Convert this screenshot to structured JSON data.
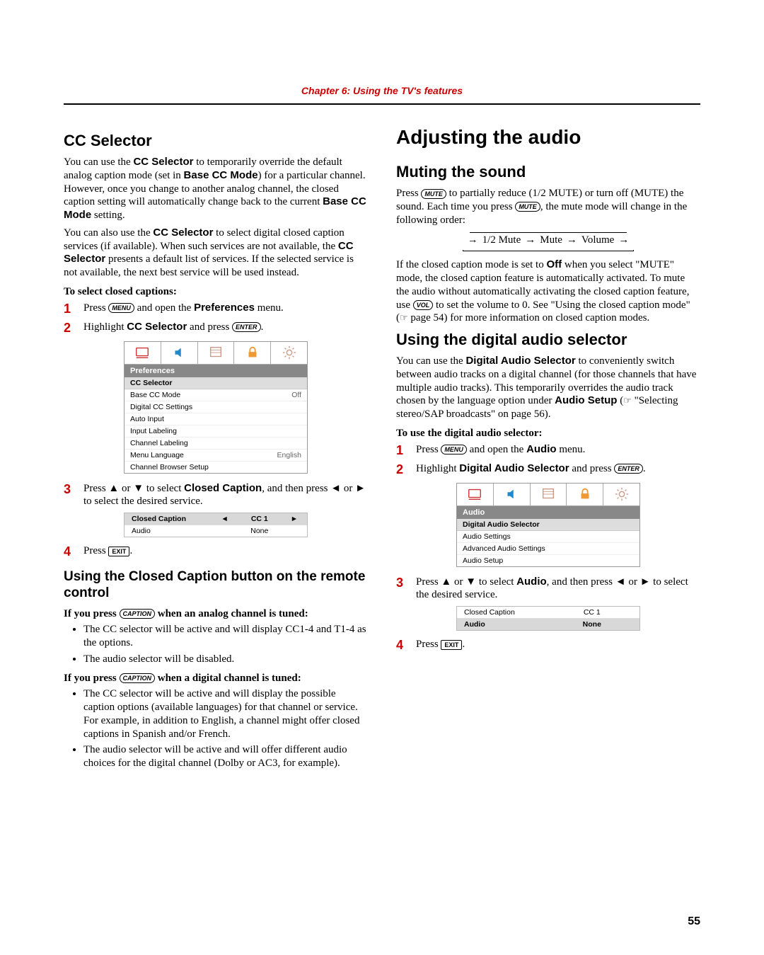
{
  "chapter_title": "Chapter 6: Using the TV's features",
  "page_number": "55",
  "left": {
    "h_cc_selector": "CC Selector",
    "p1a": "You can use the ",
    "p1b": "CC Selector",
    "p1c": " to temporarily override the default analog caption mode (set in ",
    "p1d": "Base CC Mode",
    "p1e": ") for a particular channel. However, once you change to another analog channel, the closed caption setting will automatically change back to the current ",
    "p1f": "Base CC Mode",
    "p1g": " setting.",
    "p2a": "You can also use the ",
    "p2b": "CC Selector",
    "p2c": " to select digital closed caption services (if available). When such services are not available, the ",
    "p2d": "CC Selector",
    "p2e": " presents a default list of services. If the selected service is not available, the next best service will be used instead.",
    "sub_select": "To select closed captions:",
    "s1a": "Press ",
    "s1b": " and open the ",
    "s1c": "Preferences",
    "s1d": " menu.",
    "s2a": "Highlight ",
    "s2b": "CC Selector",
    "s2c": " and press ",
    "s2d": ".",
    "menu1": {
      "head": "Preferences",
      "sel": "CC Selector",
      "rows": [
        {
          "label": "Base CC Mode",
          "val": "Off"
        },
        {
          "label": "Digital CC Settings",
          "val": ""
        },
        {
          "label": "Auto Input",
          "val": ""
        },
        {
          "label": "Input Labeling",
          "val": ""
        },
        {
          "label": "Channel Labeling",
          "val": ""
        },
        {
          "label": "Menu Language",
          "val": "English"
        },
        {
          "label": "Channel Browser Setup",
          "val": ""
        }
      ]
    },
    "s3a": "Press ▲ or ▼ to select ",
    "s3b": "Closed Caption",
    "s3c": ", and then press ◄ or ► to select the desired service.",
    "strip1": {
      "rows": [
        {
          "label": "Closed Caption",
          "val": "CC 1",
          "sel": true,
          "arrows": true
        },
        {
          "label": "Audio",
          "val": "None",
          "sel": false,
          "arrows": false
        }
      ]
    },
    "s4a": "Press ",
    "s4b": ".",
    "h_ccbutton": "Using the Closed Caption button on the remote control",
    "sub_analog_a": "If you press ",
    "sub_analog_b": " when an analog channel is tuned:",
    "bl1": "The CC selector will be active and will display CC1-4 and T1-4 as the options.",
    "bl2": "The audio selector will be disabled.",
    "sub_digital_a": "If you press ",
    "sub_digital_b": " when a digital channel is tuned:",
    "bl3": "The CC selector will be active and will display the possible caption options (available languages) for that channel or service. For example, in addition to English, a channel might offer closed captions in Spanish and/or French.",
    "bl4": "The audio selector will be active and will offer different audio choices for the digital channel (Dolby or AC3, for example)."
  },
  "right": {
    "h_adjust": "Adjusting the audio",
    "h_muting": "Muting the sound",
    "p1a": "Press ",
    "p1b": " to partially reduce (1/2 MUTE) or turn off (MUTE) the sound. Each time you press ",
    "p1c": ", the mute mode will change in the following order:",
    "flow": {
      "a": "1/2 Mute",
      "b": "Mute",
      "c": "Volume"
    },
    "p2a": "If the closed caption mode is set to ",
    "p2b": "Off",
    "p2c": " when you select \"MUTE\" mode, the closed caption feature is automatically activated. To mute the audio without automatically activating the closed caption feature, use ",
    "p2d": " to set the volume to 0. See \"Using the closed caption mode\" (",
    "p2e": " page 54) for more information on closed caption modes.",
    "h_digital": "Using the digital audio selector",
    "p3a": "You can use the ",
    "p3b": "Digital Audio Selector",
    "p3c": " to conveniently switch between audio tracks on a digital channel (for those channels that have multiple audio tracks). This temporarily overrides the audio track chosen by the language option under ",
    "p3d": "Audio Setup",
    "p3e": " (",
    "p3f": " \"Selecting stereo/SAP broadcasts\" on page 56).",
    "sub_use": "To use the digital audio selector:",
    "s1a": "Press ",
    "s1b": " and open the ",
    "s1c": "Audio",
    "s1d": " menu.",
    "s2a": "Highlight ",
    "s2b": "Digital Audio Selector",
    "s2c": " and press ",
    "s2d": ".",
    "menu2": {
      "head": "Audio",
      "sel": "Digital Audio Selector",
      "rows": [
        {
          "label": "Audio Settings",
          "val": ""
        },
        {
          "label": "Advanced Audio Settings",
          "val": ""
        },
        {
          "label": "Audio Setup",
          "val": ""
        }
      ]
    },
    "s3a": "Press ▲ or ▼ to select ",
    "s3b": "Audio",
    "s3c": ", and then press ◄ or ► to select the desired service.",
    "strip2": {
      "rows": [
        {
          "label": "Closed Caption",
          "val": "CC 1",
          "sel": false,
          "arrows": false
        },
        {
          "label": "Audio",
          "val": "None",
          "sel": true,
          "arrows": false
        }
      ]
    },
    "s4a": "Press ",
    "s4b": "."
  },
  "keys": {
    "menu": "MENU",
    "enter": "ENTER",
    "exit": "EXIT",
    "mute": "MUTE",
    "vol": "VOL",
    "caption": "CAPTION"
  }
}
